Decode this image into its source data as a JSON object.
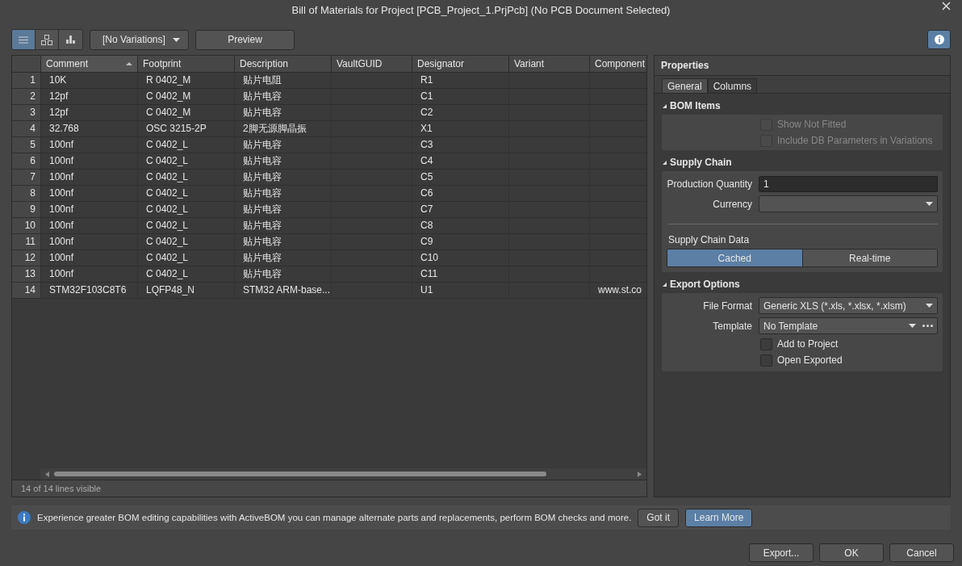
{
  "window": {
    "title": "Bill of Materials for Project [PCB_Project_1.PrjPcb] (No PCB Document Selected)"
  },
  "toolbar": {
    "view_buttons": [
      {
        "kind": "list",
        "selected": true
      },
      {
        "kind": "tree",
        "selected": false
      },
      {
        "kind": "chart",
        "selected": false
      }
    ],
    "variations": {
      "value": "[No Variations]"
    },
    "preview": "Preview"
  },
  "table": {
    "columns": [
      {
        "label": "Comment",
        "sorted": true
      },
      {
        "label": "Footprint",
        "sorted": false
      },
      {
        "label": "Description",
        "sorted": false
      },
      {
        "label": "VaultGUID",
        "sorted": false
      },
      {
        "label": "Designator",
        "sorted": false
      },
      {
        "label": "Variant",
        "sorted": false
      },
      {
        "label": "Component",
        "sorted": false
      }
    ],
    "rows": [
      {
        "number": "1",
        "cells": [
          "10K",
          "R 0402_M",
          "贴片电阻",
          null,
          "R1",
          null,
          null
        ]
      },
      {
        "number": "2",
        "cells": [
          "12pf",
          "C 0402_M",
          "贴片电容",
          null,
          "C1",
          null,
          null
        ]
      },
      {
        "number": "3",
        "cells": [
          "12pf",
          "C 0402_M",
          "贴片电容",
          null,
          "C2",
          null,
          null
        ]
      },
      {
        "number": "4",
        "cells": [
          "32.768",
          "OSC 3215-2P",
          "2脚无源脚晶振",
          null,
          "X1",
          null,
          null
        ]
      },
      {
        "number": "5",
        "cells": [
          "100nf",
          "C 0402_L",
          "贴片电容",
          null,
          "C3",
          null,
          null
        ]
      },
      {
        "number": "6",
        "cells": [
          "100nf",
          "C 0402_L",
          "贴片电容",
          null,
          "C4",
          null,
          null
        ]
      },
      {
        "number": "7",
        "cells": [
          "100nf",
          "C 0402_L",
          "贴片电容",
          null,
          "C5",
          null,
          null
        ]
      },
      {
        "number": "8",
        "cells": [
          "100nf",
          "C 0402_L",
          "贴片电容",
          null,
          "C6",
          null,
          null
        ]
      },
      {
        "number": "9",
        "cells": [
          "100nf",
          "C 0402_L",
          "贴片电容",
          null,
          "C7",
          null,
          null
        ]
      },
      {
        "number": "10",
        "cells": [
          "100nf",
          "C 0402_L",
          "贴片电容",
          null,
          "C8",
          null,
          null
        ]
      },
      {
        "number": "11",
        "cells": [
          "100nf",
          "C 0402_L",
          "贴片电容",
          null,
          "C9",
          null,
          null
        ]
      },
      {
        "number": "12",
        "cells": [
          "100nf",
          "C 0402_L",
          "贴片电容",
          null,
          "C10",
          null,
          null
        ]
      },
      {
        "number": "13",
        "cells": [
          "100nf",
          "C 0402_L",
          "贴片电容",
          null,
          "C11",
          null,
          null
        ]
      },
      {
        "number": "14",
        "cells": [
          "STM32F103C8T6",
          "LQFP48_N",
          "STM32 ARM-base...",
          null,
          "U1",
          null,
          "www.st.co"
        ]
      }
    ],
    "status": "14 of 14 lines visible"
  },
  "properties": {
    "title": "Properties",
    "tabs": [
      {
        "label": "General",
        "selected": true
      },
      {
        "label": "Columns",
        "selected": false
      }
    ],
    "bom_items": {
      "heading": "BOM Items",
      "options": [
        {
          "label": "Show Not Fitted",
          "checked": false,
          "disabled": true
        },
        {
          "label": "Include DB Parameters in Variations",
          "checked": false,
          "disabled": true
        }
      ]
    },
    "supply_chain": {
      "heading": "Supply Chain",
      "quantity_label": "Production Quantity",
      "quantity": "1",
      "currency_label": "Currency",
      "data_label": "Supply Chain Data",
      "modes": [
        {
          "label": "Cached",
          "selected": true
        },
        {
          "label": "Real-time",
          "selected": false
        }
      ]
    },
    "export_options": {
      "heading": "Export Options",
      "file_format_label": "File Format",
      "file_format": "Generic XLS (*.xls, *.xlsx, *.xlsm)",
      "template_label": "Template",
      "template": "No Template",
      "options": [
        {
          "label": "Add to Project",
          "checked": false,
          "disabled": false
        },
        {
          "label": "Open Exported",
          "checked": false,
          "disabled": false
        }
      ]
    }
  },
  "info_bar": {
    "message": "Experience greater BOM editing capabilities with ActiveBOM you can manage alternate parts and replacements, perform BOM checks and more.",
    "buttons": [
      {
        "label": "Got it",
        "kind": "plain"
      },
      {
        "label": "Learn More",
        "kind": "primary"
      }
    ]
  },
  "buttons": [
    "Export...",
    "OK",
    "Cancel"
  ]
}
